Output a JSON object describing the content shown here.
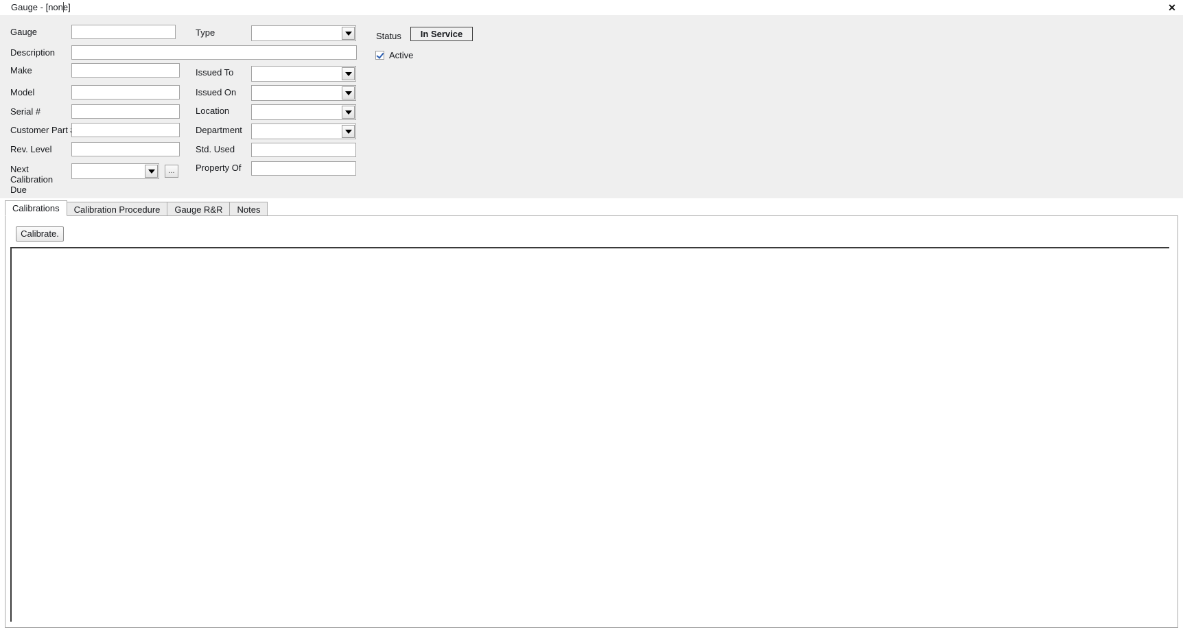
{
  "window": {
    "tab_title": "Gauge - [none]",
    "close_label": "✕"
  },
  "form": {
    "left_column": {
      "gauge_label": "Gauge",
      "gauge_value": "",
      "description_label": "Description",
      "description_value": "",
      "make_label": "Make",
      "make_value": "",
      "model_label": "Model",
      "model_value": "",
      "serial_label": "Serial #",
      "serial_value": "",
      "customer_part_label": "Customer Part #",
      "customer_part_value": "",
      "rev_level_label": "Rev. Level",
      "rev_level_value": "",
      "next_cal_due_label_line1": "Next",
      "next_cal_due_label_line2": "Calibration",
      "next_cal_due_label_line3": "Due",
      "next_cal_due_value": "",
      "browse_label": "..."
    },
    "middle_column": {
      "type_label": "Type",
      "type_value": "",
      "issued_to_label": "Issued To",
      "issued_to_value": "",
      "issued_on_label": "Issued On",
      "issued_on_value": "",
      "location_label": "Location",
      "location_value": "",
      "department_label": "Department",
      "department_value": "",
      "std_used_label": "Std. Used",
      "std_used_value": "",
      "property_of_label": "Property Of",
      "property_of_value": ""
    },
    "right_column": {
      "status_label": "Status",
      "status_value": "In Service",
      "active_label": "Active",
      "active_checked": true
    }
  },
  "tabs": [
    {
      "label": "Calibrations",
      "active": true
    },
    {
      "label": "Calibration Procedure",
      "active": false
    },
    {
      "label": "Gauge R&R",
      "active": false
    },
    {
      "label": "Notes",
      "active": false
    }
  ],
  "calibrations_panel": {
    "calibrate_button": "Calibrate.",
    "grid_rows": []
  },
  "colors": {
    "surface": "#efefef",
    "panel": "#ffffff",
    "border": "#a4a4a4",
    "check_accent": "#2a5db0",
    "text": "#16181c"
  }
}
